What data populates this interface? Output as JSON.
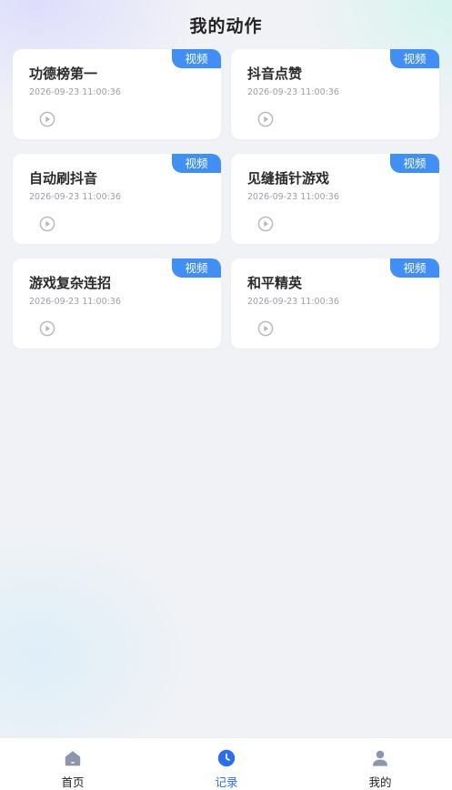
{
  "header": {
    "title": "我的动作"
  },
  "colors": {
    "accent": "#3f8ff5",
    "active_tab": "#2c6df0",
    "inactive_icon": "#8d96ad"
  },
  "cards": [
    {
      "name": "功德榜第一",
      "time": "2026-09-23 11:00:36",
      "tag": "视频",
      "icon": "play-circle-icon"
    },
    {
      "name": "抖音点赞",
      "time": "2026-09-23 11:00:36",
      "tag": "视频",
      "icon": "play-circle-icon"
    },
    {
      "name": "自动刷抖音",
      "time": "2026-09-23 11:00:36",
      "tag": "视频",
      "icon": "play-circle-icon"
    },
    {
      "name": "见缝插针游戏",
      "time": "2026-09-23 11:00:36",
      "tag": "视频",
      "icon": "play-circle-icon"
    },
    {
      "name": "游戏复杂连招",
      "time": "2026-09-23 11:00:36",
      "tag": "视频",
      "icon": "play-circle-icon"
    },
    {
      "name": "和平精英",
      "time": "2026-09-23 11:00:36",
      "tag": "视频",
      "icon": "play-circle-icon"
    }
  ],
  "tabbar": {
    "items": [
      {
        "label": "首页",
        "icon": "home-icon",
        "active": false
      },
      {
        "label": "记录",
        "icon": "clock-icon",
        "active": true
      },
      {
        "label": "我的",
        "icon": "user-icon",
        "active": false
      }
    ]
  }
}
